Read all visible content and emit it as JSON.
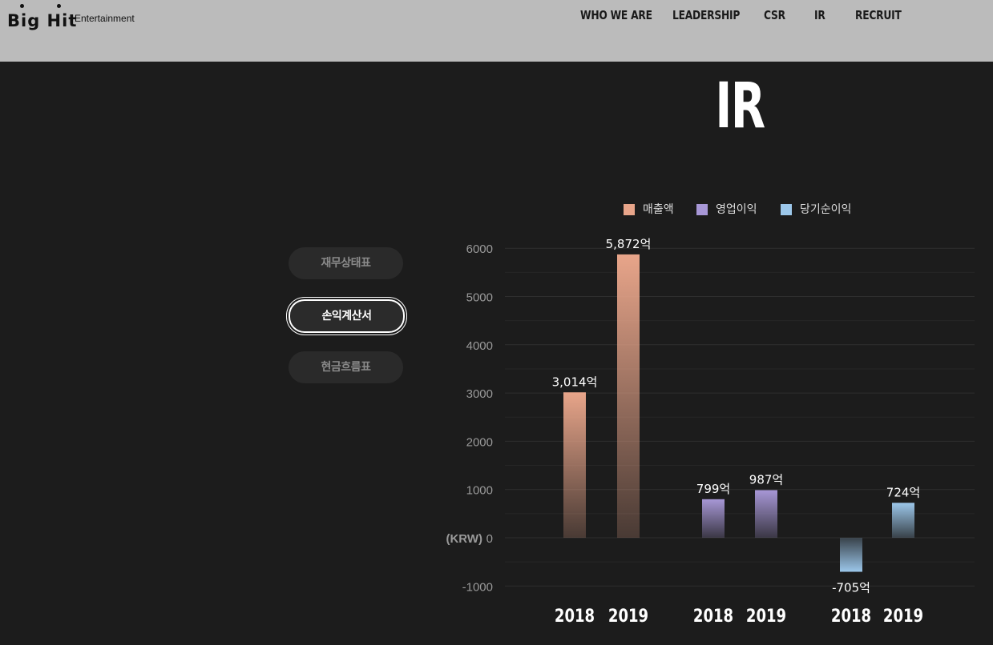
{
  "brand": {
    "logo_main": "Big Hit",
    "logo_sub": "Entertainment"
  },
  "nav": {
    "items": [
      {
        "label": "WHO WE ARE"
      },
      {
        "label": "LEADERSHIP"
      },
      {
        "label": "CSR"
      },
      {
        "label": "IR"
      },
      {
        "label": "RECRUIT"
      }
    ]
  },
  "page": {
    "title": "IR"
  },
  "tabs": [
    {
      "label": "재무상태표",
      "active": false
    },
    {
      "label": "손익계산서",
      "active": true
    },
    {
      "label": "현금흐름표",
      "active": false
    }
  ],
  "colors": {
    "revenue": "#e8a58a",
    "operating_income": "#a797d6",
    "net_income": "#9cc7ea",
    "background": "#1c1c1c",
    "header": "#bbbbbb"
  },
  "chart_data": {
    "type": "bar",
    "legend_position": "top",
    "grid": true,
    "ylabel": "(KRW)",
    "ylim": [
      -1000,
      6000
    ],
    "yticks": [
      -1000,
      0,
      1000,
      2000,
      3000,
      4000,
      5000,
      6000
    ],
    "series": [
      {
        "name": "매출액",
        "color": "#e8a58a",
        "categories": [
          "2018",
          "2019"
        ],
        "values": [
          3014,
          5872
        ],
        "value_labels": [
          "3,014억",
          "5,872억"
        ]
      },
      {
        "name": "영업이익",
        "color": "#a797d6",
        "categories": [
          "2018",
          "2019"
        ],
        "values": [
          799,
          987
        ],
        "value_labels": [
          "799억",
          "987억"
        ]
      },
      {
        "name": "당기순이익",
        "color": "#9cc7ea",
        "categories": [
          "2018",
          "2019"
        ],
        "values": [
          -705,
          724
        ],
        "value_labels": [
          "-705억",
          "724억"
        ]
      }
    ]
  }
}
